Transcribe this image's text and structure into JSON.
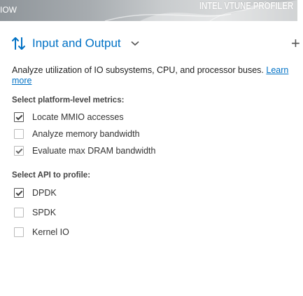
{
  "banner": {
    "left_text": "IOW",
    "right_text": "INTEL VTUNE PROFILER"
  },
  "header": {
    "title": "Input and Output",
    "sort_icon": "sort-arrows-icon",
    "chevron_icon": "chevron-down-icon",
    "add_icon": "plus-icon",
    "add_label": "+"
  },
  "description": {
    "text": "Analyze utilization of IO subsystems, CPU, and processor buses.",
    "link": "Learn more"
  },
  "platform_metrics": {
    "label": "Select platform-level metrics:",
    "options": [
      {
        "label": "Locate MMIO accesses",
        "checked": true
      },
      {
        "label": "Analyze memory bandwidth",
        "checked": false
      },
      {
        "label": "Evaluate max DRAM bandwidth",
        "checked": true
      }
    ]
  },
  "api_profile": {
    "label": "Select API to profile:",
    "options": [
      {
        "label": "DPDK",
        "checked": true
      },
      {
        "label": "SPDK",
        "checked": false
      },
      {
        "label": "Kernel IO",
        "checked": false
      }
    ]
  },
  "colors": {
    "accent": "#0071c5"
  }
}
